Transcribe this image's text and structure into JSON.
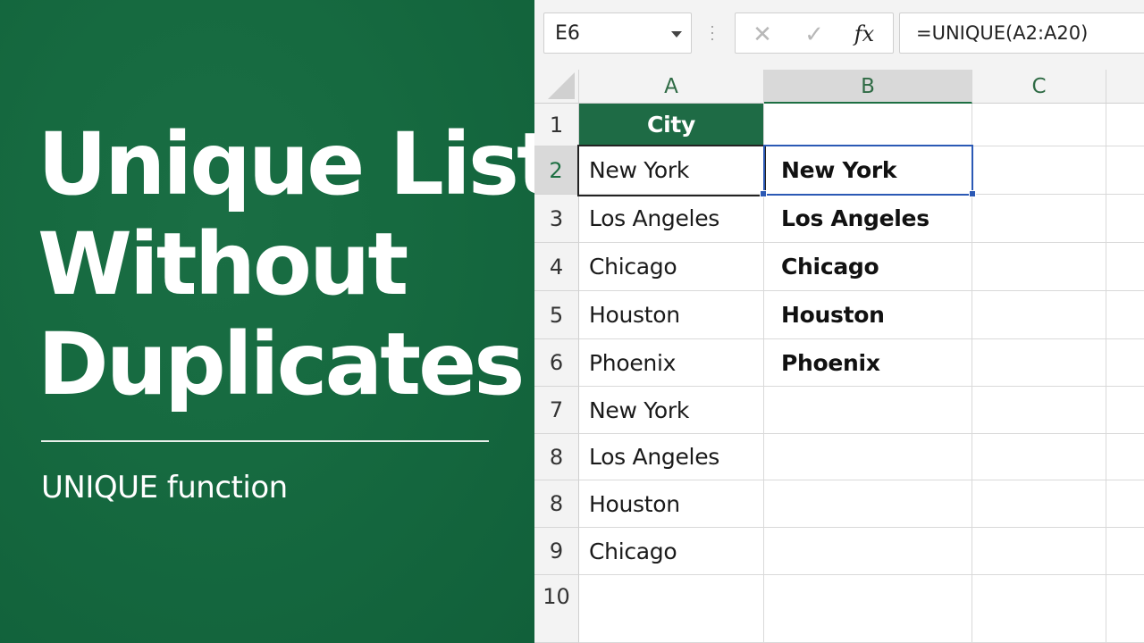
{
  "title_lines": [
    "Unique List",
    "Without",
    "Duplicates"
  ],
  "subtitle": "UNIQUE function",
  "formula_bar": {
    "name_box": "E6",
    "cancel_icon": "✕",
    "confirm_icon": "✓",
    "fx_label": "fx",
    "formula": "=UNIQUE(A2:A20)"
  },
  "columns": [
    "A",
    "B",
    "C"
  ],
  "rows": [
    "1",
    "2",
    "3",
    "4",
    "5",
    "6",
    "7",
    "8",
    "8",
    "9",
    "10"
  ],
  "column_a": [
    "City",
    "New York",
    "Los Angeles",
    "Chicago",
    "Houston",
    "Phoenix",
    "New York",
    "Los Angeles",
    "Houston",
    "Chicago",
    ""
  ],
  "column_b": [
    "",
    "New York",
    "Los Angeles",
    "Chicago",
    "Houston",
    "Phoenix",
    "",
    "",
    "",
    "",
    ""
  ],
  "colors": {
    "brand_green": "#1e6b45",
    "selection_blue": "#2b59b5"
  }
}
